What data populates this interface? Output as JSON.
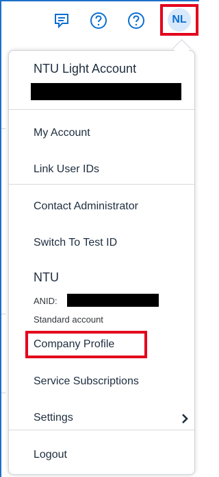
{
  "header": {
    "feedback_icon": "feedback-icon",
    "help_icon": "help-icon",
    "avatar_initials": "NL"
  },
  "account": {
    "title": "NTU Light Account"
  },
  "menu": {
    "items": [
      {
        "label": "My Account"
      },
      {
        "label": "Link User IDs"
      },
      {
        "label": "Contact Administrator"
      },
      {
        "label": "Switch To Test ID"
      }
    ]
  },
  "organization": {
    "name": "NTU",
    "anid_label": "ANID:",
    "account_type": "Standard account"
  },
  "org_menu": {
    "company_profile": "Company Profile",
    "service_subscriptions": "Service Subscriptions",
    "settings": "Settings"
  },
  "footer": {
    "logout": "Logout"
  },
  "colors": {
    "accent": "#0a6ed1",
    "highlight": "#e4001b",
    "avatar_bg": "#d8e9fb",
    "text": "#1d2d3e"
  }
}
